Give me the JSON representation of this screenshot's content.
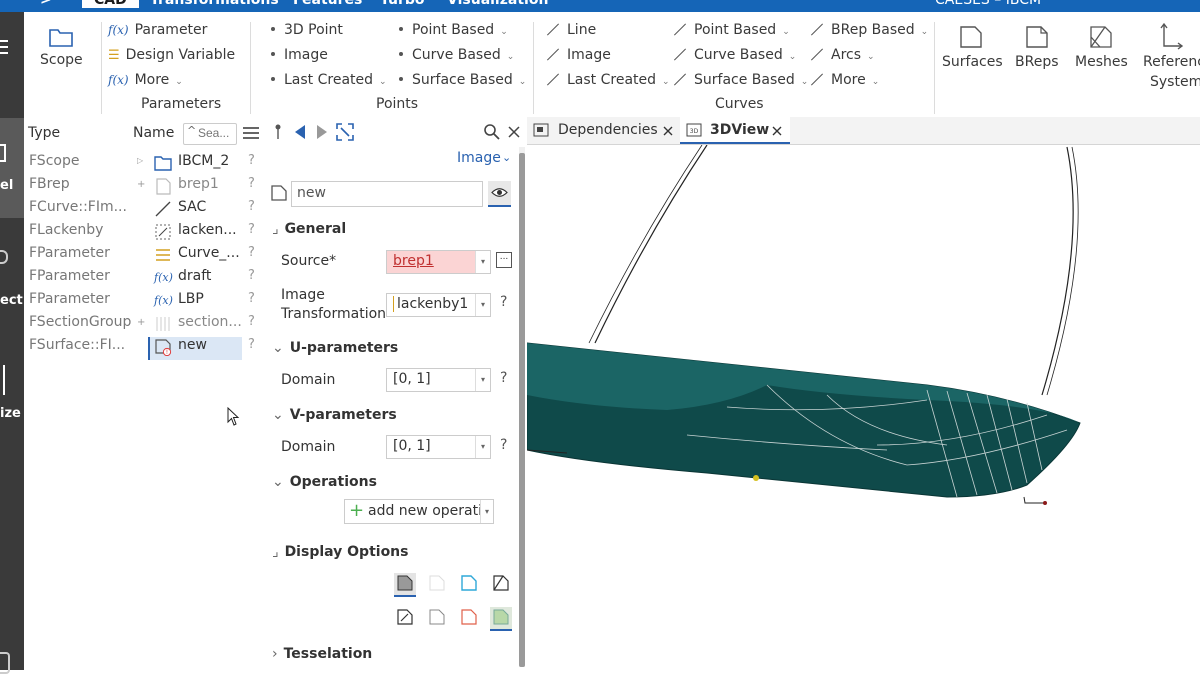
{
  "topbar": {
    "tabs": [
      ">",
      "CAD",
      "Transformations",
      "Features",
      "Turbo",
      "Visualization"
    ],
    "title": "CAESES – IBCM*"
  },
  "leftstrip": {
    "labels": [
      "el",
      "ect",
      "ize"
    ]
  },
  "ribbon": {
    "scope": {
      "label": "Scope"
    },
    "parameters": {
      "items": [
        "Parameter",
        "Design Variable",
        "More"
      ],
      "group": "Parameters"
    },
    "points": {
      "col1": [
        "3D Point",
        "Image",
        "Last Created"
      ],
      "col2": [
        "Point Based",
        "Curve Based",
        "Surface Based"
      ],
      "group": "Points"
    },
    "curves": {
      "col1": [
        "Line",
        "Image",
        "Last Created"
      ],
      "col2": [
        "Point Based",
        "Curve Based",
        "Surface Based"
      ],
      "col3": [
        "BRep Based",
        "Arcs",
        "More"
      ],
      "group": "Curves"
    },
    "big": [
      "Surfaces",
      "BReps",
      "Meshes",
      "Reference",
      "Systems"
    ]
  },
  "tree": {
    "headers": {
      "type": "Type",
      "name": "Name",
      "search_placeholder": "Sea..."
    },
    "rows": [
      {
        "type": "FScope",
        "name": "IBCM_2",
        "icon": "folder-icon"
      },
      {
        "type": "FBrep",
        "name": "brep1",
        "icon": "brep-icon"
      },
      {
        "type": "FCurve::FIm...",
        "name": "SAC",
        "icon": "curve-icon"
      },
      {
        "type": "FLackenby",
        "name": "lacken...",
        "icon": "lackenby-icon"
      },
      {
        "type": "FParameter",
        "name": "Curve_...",
        "icon": "design-variable-icon"
      },
      {
        "type": "FParameter",
        "name": "draft",
        "icon": "fx-icon"
      },
      {
        "type": "FParameter",
        "name": "LBP",
        "icon": "fx-icon"
      },
      {
        "type": "FSectionGroup",
        "name": "section...",
        "icon": "section-group-icon"
      },
      {
        "type": "FSurface::FI...",
        "name": "new",
        "icon": "surface-error-icon"
      }
    ],
    "q": "?"
  },
  "props": {
    "mode": "Image",
    "name_value": "new",
    "general": "General",
    "source_label": "Source*",
    "source_value": "brep1",
    "imgtrans_label1": "Image",
    "imgtrans_label2": "Transformation",
    "imgtrans_value": "lackenby1",
    "u_params": "U-parameters",
    "v_params": "V-parameters",
    "domain_label": "Domain",
    "u_domain": "[0, 1]",
    "v_domain": "[0, 1]",
    "operations": "Operations",
    "add_op": "add new operatic",
    "display": "Display Options",
    "tesselation": "Tesselation",
    "q": "?"
  },
  "viewtabs": {
    "dependencies": "Dependencies",
    "view3d": "3DView"
  },
  "colors": {
    "accent": "#1565b7",
    "hull": "#0f4a4a",
    "error": "#e03c3c"
  }
}
